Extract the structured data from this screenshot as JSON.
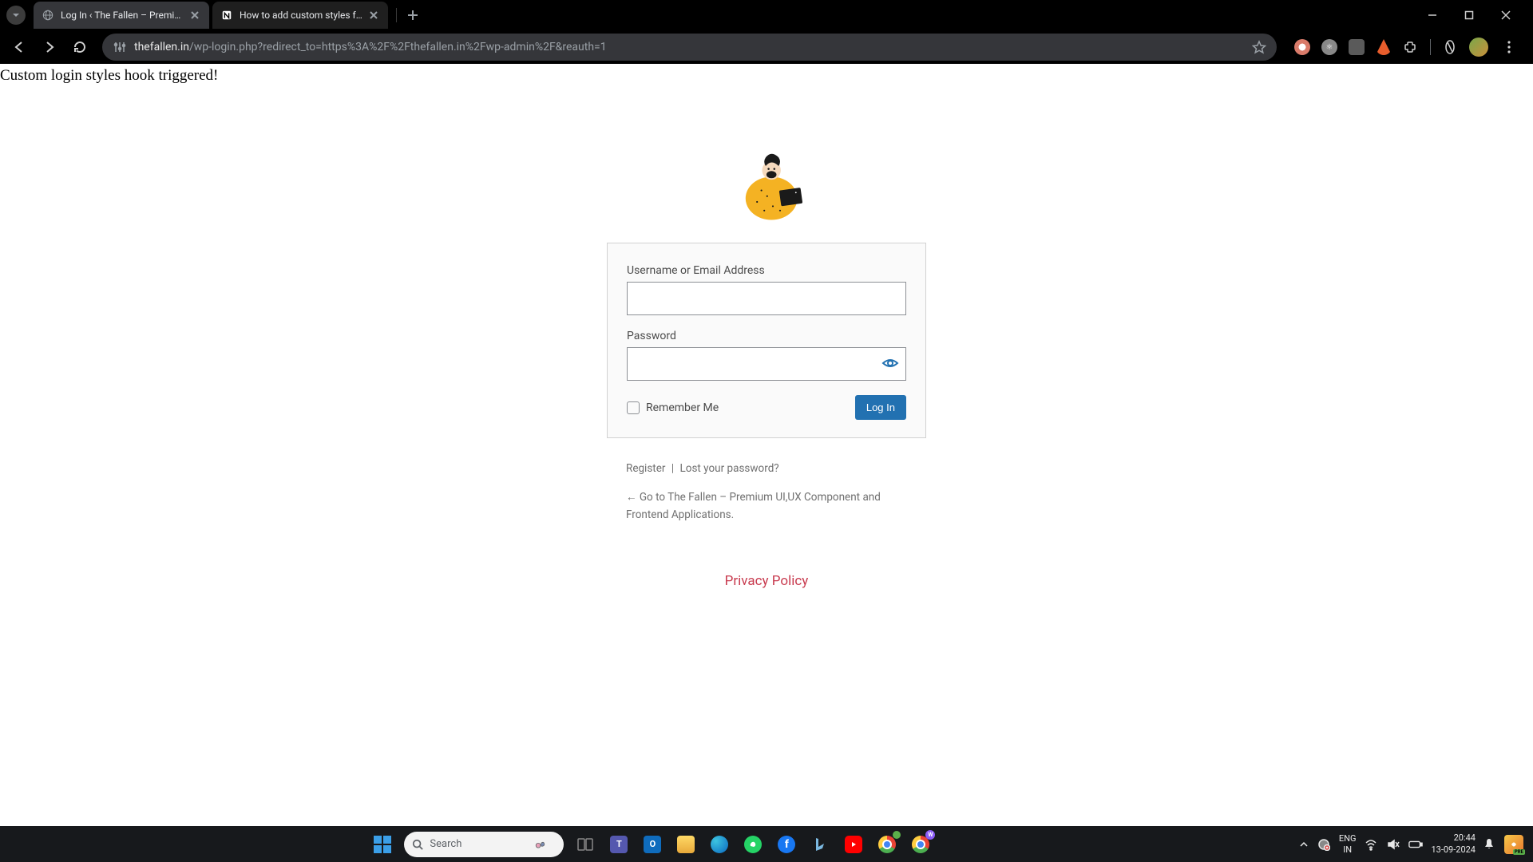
{
  "browser": {
    "tabs": [
      {
        "title": "Log In ‹ The Fallen – Premium U",
        "active": true
      },
      {
        "title": "How to add custom styles for W",
        "active": false
      }
    ],
    "url_host": "thefallen.in",
    "url_path": "/wp-login.php?redirect_to=https%3A%2F%2Fthefallen.in%2Fwp-admin%2F&reauth=1"
  },
  "page": {
    "debug_message": "Custom login styles hook triggered!",
    "login": {
      "username_label": "Username or Email Address",
      "password_label": "Password",
      "remember_label": "Remember Me",
      "login_button": "Log In"
    },
    "links": {
      "register": "Register",
      "separator": "|",
      "lost_password": "Lost your password?",
      "go_back": "← Go to The Fallen – Premium UI,UX Component and Frontend Applications."
    },
    "privacy": "Privacy Policy"
  },
  "taskbar": {
    "search_placeholder": "Search",
    "lang_top": "ENG",
    "lang_bottom": "IN",
    "time": "20:44",
    "date": "13-09-2024",
    "copilot_tag": "PRE"
  }
}
